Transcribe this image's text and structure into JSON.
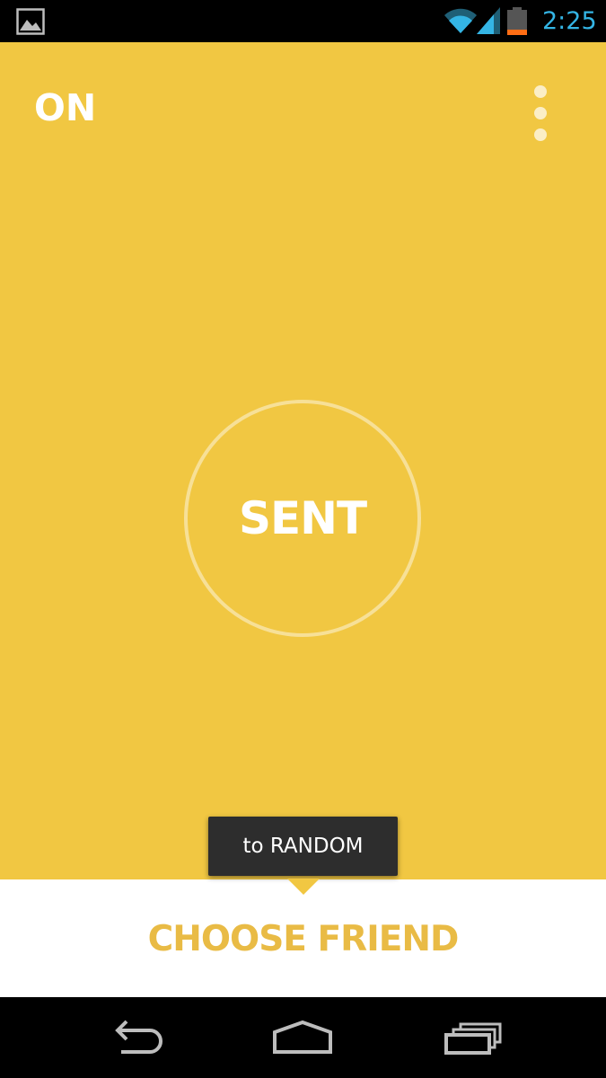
{
  "status_bar": {
    "time": "2:25",
    "icons": [
      "gallery-notification-icon",
      "wifi-icon",
      "signal-icon",
      "battery-icon"
    ],
    "time_color": "#34b5e5"
  },
  "main": {
    "background_color": "#f1c742",
    "power_label": "ON",
    "overflow_icon": "overflow-menu-icon",
    "send_button_label": "SENT"
  },
  "tooltip": {
    "text": "to RANDOM",
    "background_color": "#2d2d2d"
  },
  "bottom_panel": {
    "choose_friend_label": "CHOOSE FRIEND",
    "label_color": "#e9bb45"
  },
  "nav_bar": {
    "icons": [
      "back-icon",
      "home-icon",
      "recents-icon"
    ]
  }
}
